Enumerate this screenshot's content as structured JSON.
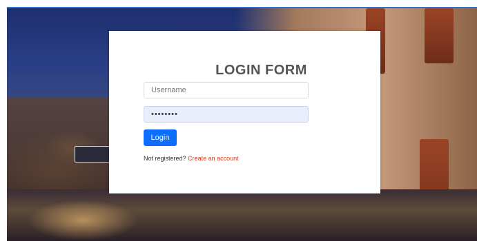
{
  "login_form": {
    "title": "LOGIN FORM",
    "username_placeholder": "Username",
    "password_value": "password",
    "login_button_label": "Login",
    "register_prompt": "Not registered?",
    "register_link_label": "Create an account"
  },
  "colors": {
    "primary_button": "#0d6efd",
    "link": "#d9381e",
    "title": "#555555",
    "window_border": "#2f73c9"
  }
}
